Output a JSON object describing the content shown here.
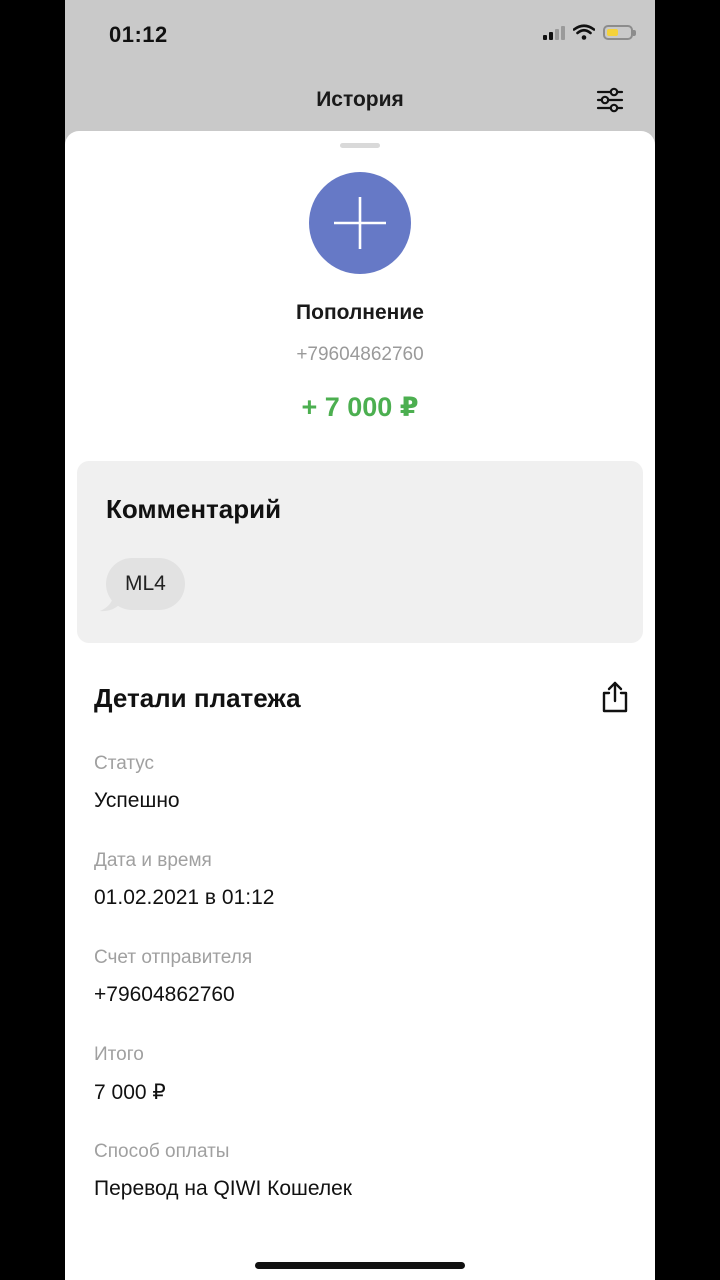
{
  "status_bar": {
    "time": "01:12"
  },
  "nav": {
    "title": "История",
    "filter_icon": "filter-sliders-icon"
  },
  "operation": {
    "icon": "plus-icon",
    "icon_color": "#6679c6",
    "title": "Пополнение",
    "account": "+79604862760",
    "amount": "+ 7 000 ₽",
    "amount_color": "#4caf50"
  },
  "comment": {
    "title": "Комментарий",
    "text": "ML4"
  },
  "details": {
    "title": "Детали платежа",
    "share_icon": "share-icon",
    "fields": [
      {
        "label": "Статус",
        "value": "Успешно"
      },
      {
        "label": "Дата и время",
        "value": "01.02.2021 в 01:12"
      },
      {
        "label": "Счет отправителя",
        "value": "+79604862760"
      },
      {
        "label": "Итого",
        "value": "7 000 ₽"
      },
      {
        "label": "Способ оплаты",
        "value": "Перевод на QIWI Кошелек"
      }
    ]
  }
}
